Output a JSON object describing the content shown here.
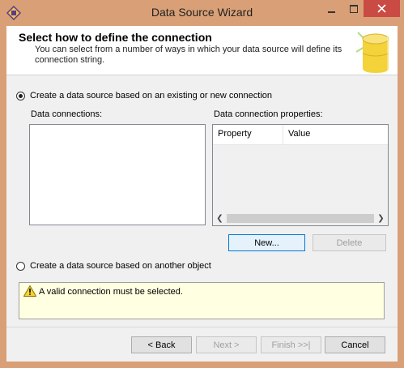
{
  "window": {
    "title": "Data Source Wizard",
    "controls": {
      "minimize": "minimize",
      "maximize": "maximize",
      "close": "close"
    }
  },
  "header": {
    "title": "Select how to define the connection",
    "description": "You can select from a number of ways in which your data source will define its connection string."
  },
  "option_existing": {
    "label": "Create a data source based on an existing or new connection",
    "checked": true
  },
  "data_connections": {
    "label": "Data connections:",
    "items": []
  },
  "connection_properties": {
    "label": "Data connection properties:",
    "columns": [
      "Property",
      "Value"
    ]
  },
  "buttons": {
    "new": "New...",
    "delete": "Delete"
  },
  "option_other": {
    "label": "Create a data source based on another object",
    "checked": false
  },
  "warning": {
    "text": "A valid connection must be selected."
  },
  "footer": {
    "back": "< Back",
    "next": "Next >",
    "finish": "Finish >>|",
    "cancel": "Cancel"
  },
  "colors": {
    "frame": "#d9a077",
    "close": "#c94b43",
    "warning_bg": "#ffffe1",
    "focus": "#0078d7"
  }
}
